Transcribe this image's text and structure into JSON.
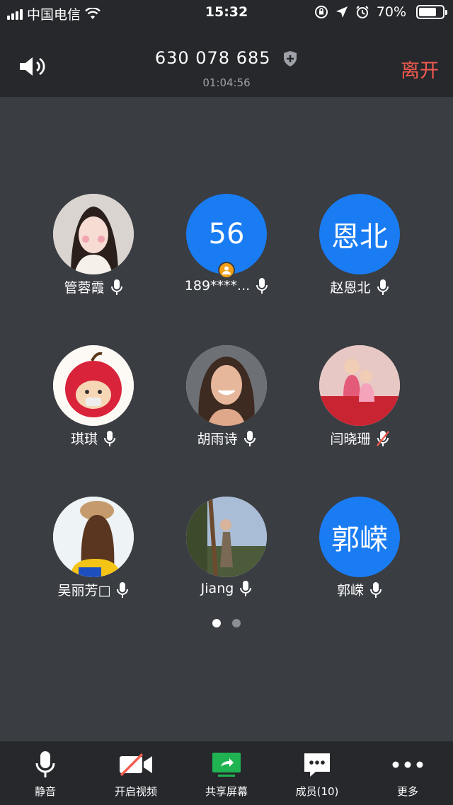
{
  "status_bar": {
    "carrier": "中国电信",
    "time": "15:32",
    "battery": "70%"
  },
  "header": {
    "meeting_id": "630 078 685",
    "duration": "01:04:56",
    "leave_label": "离开"
  },
  "participants": [
    {
      "name": "管蓉霞",
      "avatar_text": "",
      "mic": "on"
    },
    {
      "name": "189****...",
      "avatar_text": "56",
      "mic": "on",
      "host_badge": true
    },
    {
      "name": "赵恩北",
      "avatar_text": "恩北",
      "mic": "on"
    },
    {
      "name": "琪琪",
      "avatar_text": "",
      "mic": "on"
    },
    {
      "name": "胡雨诗",
      "avatar_text": "",
      "mic": "on"
    },
    {
      "name": "闫晓珊",
      "avatar_text": "",
      "mic": "muted"
    },
    {
      "name": "吴丽芳□",
      "avatar_text": "",
      "mic": "on"
    },
    {
      "name": "Jiang",
      "avatar_text": "",
      "mic": "on"
    },
    {
      "name": "郭嵘",
      "avatar_text": "郭嵘",
      "mic": "on"
    }
  ],
  "pagination": {
    "current": 1,
    "total": 2
  },
  "toolbar": {
    "mute": "静音",
    "video": "开启视频",
    "share": "共享屏幕",
    "members": "成员(10)",
    "more": "更多"
  },
  "colors": {
    "accent_blue": "#1a7cf3",
    "leave_red": "#f25b4f",
    "share_green": "#1fb451",
    "background": "#3a3d42",
    "bar": "#26282c"
  }
}
